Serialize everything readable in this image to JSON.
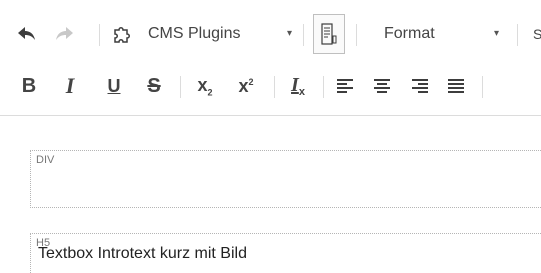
{
  "toolbar": {
    "row1": {
      "undo_icon": "undo-icon",
      "redo_icon": "redo-icon",
      "plugins_icon": "puzzle-icon",
      "plugins_label": "CMS Plugins",
      "dropdown_arrow": "▾",
      "show_blocks_icon": "show-blocks-icon",
      "format_label": "Format",
      "styles_label": "S"
    },
    "row2": {
      "bold": "B",
      "italic": "I",
      "underline": "U",
      "strike": "S",
      "subscript": "x",
      "subscript_mark": "2",
      "superscript": "x",
      "superscript_mark": "2",
      "remove_format": "I",
      "remove_format_mark": "x"
    }
  },
  "editor": {
    "div_tag": "DIV",
    "h5_tag": "H5",
    "h5_text": "Textbox Introtext kurz mit Bild"
  }
}
